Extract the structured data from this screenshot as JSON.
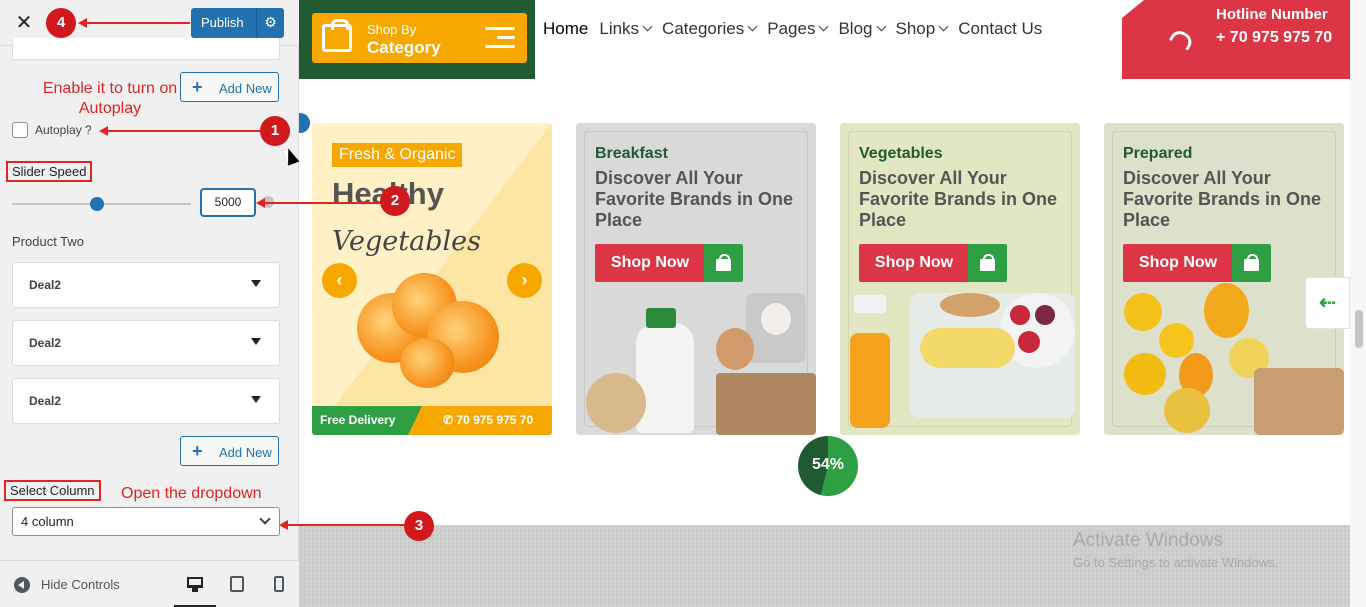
{
  "panel": {
    "publish_label": "Publish",
    "add_new_label": "Add New",
    "autoplay_label": "Autoplay ?",
    "slider_speed_label": "Slider Speed",
    "slider_speed_value": "5000",
    "product_two_label": "Product Two",
    "deals": [
      "Deal2",
      "Deal2",
      "Deal2"
    ],
    "select_column_label": "Select Column",
    "select_column_value": "4 column",
    "hide_controls_label": "Hide Controls"
  },
  "annotations": {
    "autoplay_note": "Enable it to turn on Autoplay",
    "dropdown_note": "Open the dropdown",
    "steps": [
      "1",
      "2",
      "3",
      "4"
    ]
  },
  "header": {
    "shop_by": "Shop By",
    "category": "Category",
    "nav": [
      {
        "label": "Home",
        "dropdown": false
      },
      {
        "label": "Links",
        "dropdown": true
      },
      {
        "label": "Categories",
        "dropdown": true
      },
      {
        "label": "Pages",
        "dropdown": true
      },
      {
        "label": "Blog",
        "dropdown": true
      },
      {
        "label": "Shop",
        "dropdown": true
      },
      {
        "label": "Contact Us",
        "dropdown": false
      }
    ],
    "hotline_title": "Hotline Number",
    "hotline_number": "+ 70 975 975 70"
  },
  "slider": {
    "main_card": {
      "badge": "Fresh & Organic",
      "title": "Healthy",
      "subtitle": "Vegetables",
      "free_delivery": "Free Delivery",
      "phone": "70 975 975 70"
    },
    "promos": [
      {
        "category": "Breakfast",
        "heading": "Discover All Your Favorite Brands in One Place",
        "button": "Shop Now"
      },
      {
        "category": "Vegetables",
        "heading": "Discover All Your Favorite Brands in One Place",
        "button": "Shop Now"
      },
      {
        "category": "Prepared",
        "heading": "Discover All Your Favorite Brands in One Place",
        "button": "Shop Now"
      }
    ],
    "progress_percent": 54,
    "progress_label": "54%"
  },
  "watermark": {
    "line1": "Activate Windows",
    "line2": "Go to Settings to activate Windows."
  },
  "colors": {
    "wp_blue": "#2271b1",
    "brand_green": "#1f5a32",
    "accent_orange": "#f7a800",
    "accent_red": "#dc3545",
    "annotation_red": "#e02424"
  }
}
